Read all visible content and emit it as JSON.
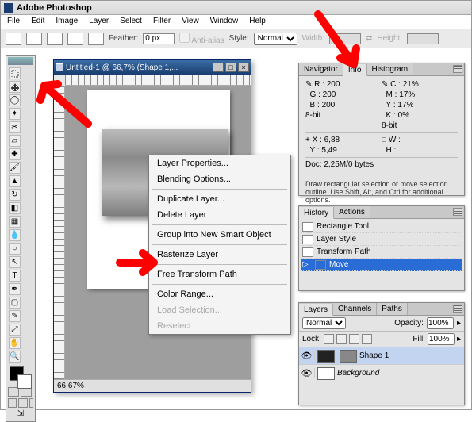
{
  "title": "Adobe Photoshop",
  "menu": [
    "File",
    "Edit",
    "Image",
    "Layer",
    "Select",
    "Filter",
    "View",
    "Window",
    "Help"
  ],
  "options": {
    "feather_label": "Feather:",
    "feather_value": "0 px",
    "antialias": "Anti-alias",
    "style_label": "Style:",
    "style_value": "Normal",
    "width_label": "Width:",
    "height_label": "Height:"
  },
  "doc": {
    "title": "Untitled-1 @ 66,7% (Shape 1,...",
    "zoom": "66,67%"
  },
  "context_menu": [
    {
      "label": "Layer Properties...",
      "enabled": true
    },
    {
      "label": "Blending Options...",
      "enabled": true
    },
    {
      "sep": true
    },
    {
      "label": "Duplicate Layer...",
      "enabled": true
    },
    {
      "label": "Delete Layer",
      "enabled": true
    },
    {
      "sep": true
    },
    {
      "label": "Group into New Smart Object",
      "enabled": true
    },
    {
      "sep": true
    },
    {
      "label": "Rasterize Layer",
      "enabled": true
    },
    {
      "sep": true
    },
    {
      "label": "Free Transform Path",
      "enabled": true
    },
    {
      "sep": true
    },
    {
      "label": "Color Range...",
      "enabled": true
    },
    {
      "label": "Load Selection...",
      "enabled": false
    },
    {
      "label": "Reselect",
      "enabled": false
    }
  ],
  "info": {
    "tabs": [
      "Navigator",
      "Info",
      "Histogram"
    ],
    "active_tab": 1,
    "rgb": {
      "R": "200",
      "G": "200",
      "B": "200"
    },
    "cmyk": {
      "C": "21%",
      "M": "17%",
      "Y": "17%",
      "K": "0%"
    },
    "mode_a": "8-bit",
    "mode_b": "8-bit",
    "xy": {
      "X": "6,88",
      "Y": "5,49"
    },
    "wh": {
      "W": "",
      "H": ""
    },
    "docsize": "Doc: 2,25M/0 bytes",
    "hint": "Draw rectangular selection or move selection outline.  Use Shift, Alt, and Ctrl for additional options."
  },
  "history": {
    "tabs": [
      "History",
      "Actions"
    ],
    "items": [
      "Rectangle Tool",
      "Layer Style",
      "Transform Path",
      "Move"
    ],
    "selected": 3
  },
  "layers": {
    "tabs": [
      "Layers",
      "Channels",
      "Paths"
    ],
    "blend": "Normal",
    "opacity_label": "Opacity:",
    "opacity": "100%",
    "lock_label": "Lock:",
    "fill_label": "Fill:",
    "fill": "100%",
    "items": [
      {
        "name": "Shape 1",
        "selected": true,
        "dark": true
      },
      {
        "name": "Background",
        "selected": false,
        "dark": false
      }
    ]
  }
}
